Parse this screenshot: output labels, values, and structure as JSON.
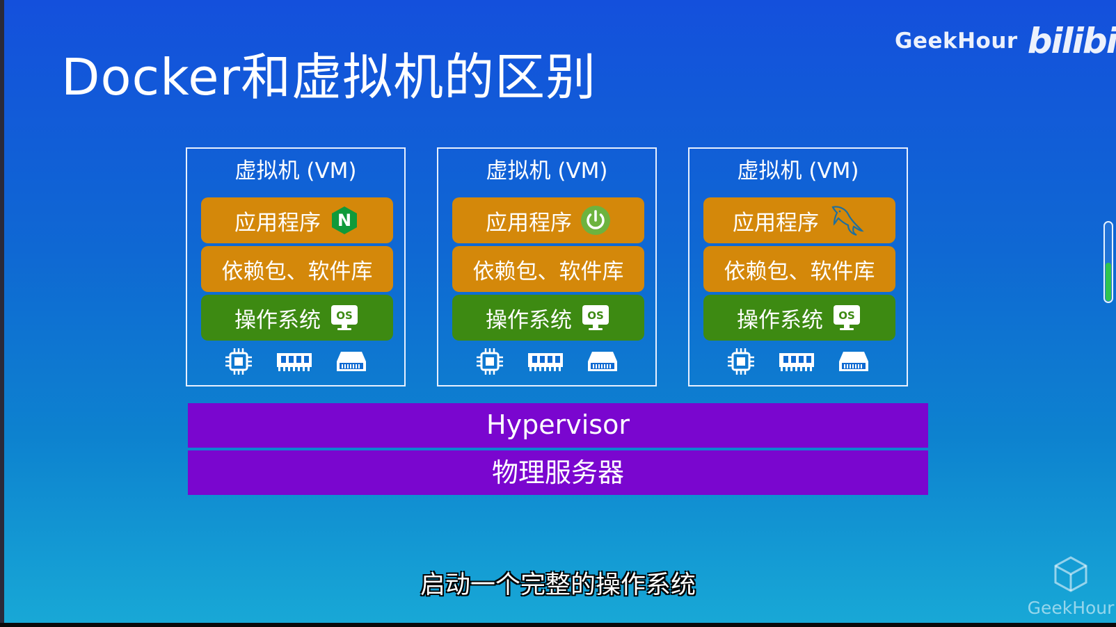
{
  "slide": {
    "title": "Docker和虚拟机的区别",
    "brand": "GeekHour",
    "bili_logo": "bilibili",
    "subtitle": "启动一个完整的操作系统",
    "watermark": "GeekHour"
  },
  "vms": [
    {
      "title": "虚拟机 (VM)",
      "app": "应用程序",
      "app_icon": "nginx-icon",
      "deps": "依赖包、软件库",
      "os": "操作系统",
      "os_badge": "OS"
    },
    {
      "title": "虚拟机 (VM)",
      "app": "应用程序",
      "app_icon": "power-icon",
      "deps": "依赖包、软件库",
      "os": "操作系统",
      "os_badge": "OS"
    },
    {
      "title": "虚拟机 (VM)",
      "app": "应用程序",
      "app_icon": "mysql-dolphin-icon",
      "deps": "依赖包、软件库",
      "os": "操作系统",
      "os_badge": "OS"
    }
  ],
  "hardware_icons": [
    "cpu-icon",
    "memory-icon",
    "disk-icon"
  ],
  "layers": {
    "hypervisor": "Hypervisor",
    "physical_server": "物理服务器"
  },
  "progress": {
    "fraction": 0.48
  },
  "colors": {
    "app_layer": "#d4880a",
    "os_layer": "#3d8a12",
    "platform_layer": "#7a06cf",
    "background_top": "#1450dc",
    "background_bottom": "#18a8d6"
  }
}
